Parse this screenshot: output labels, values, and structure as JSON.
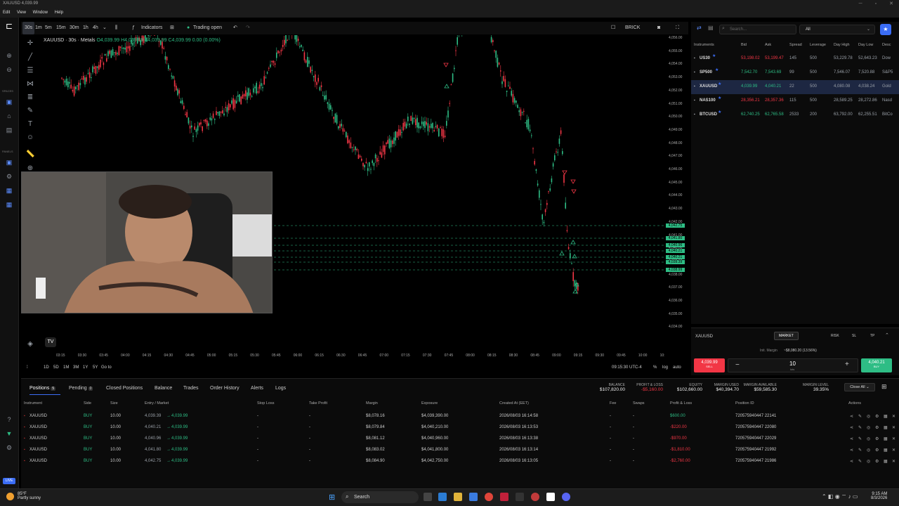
{
  "window": {
    "title": "XAUUSD 4,039.99",
    "menu": [
      "Edit",
      "View",
      "Window",
      "Help"
    ]
  },
  "toolbar": {
    "timeframes": [
      "30s",
      "1m",
      "5m",
      "15m",
      "30m",
      "1h",
      "4h"
    ],
    "active_timeframe": "30s",
    "indicators_label": "Indicators",
    "trading_status": "Trading open",
    "chart_type": "BRICK"
  },
  "chart": {
    "symbol_label": "XAUUSD · 30s · Metals",
    "ohlc": "O4,039.99 H4,039.99 L4,039.99 C4,039.99 0.00 (0.00%)",
    "y_labels": [
      "4,056.00",
      "4,055.00",
      "4,054.00",
      "4,053.00",
      "4,052.00",
      "4,051.00",
      "4,050.00",
      "4,049.00",
      "4,048.00",
      "4,047.00",
      "4,046.00",
      "4,045.00",
      "4,044.00",
      "4,043.00",
      "4,042.00",
      "4,041.00",
      "4,040.00",
      "4,039.00",
      "4,038.00",
      "4,037.00",
      "4,036.00",
      "4,035.00",
      "4,034.00"
    ],
    "price_tags": [
      "4,042.75",
      "4,041.80",
      "4,040.96",
      "4,040.21",
      "4,040.21",
      "4,039.39",
      "4,038.99"
    ],
    "x_labels": [
      "03:15",
      "03:30",
      "03:45",
      "04:00",
      "04:15",
      "04:30",
      "04:45",
      "05:00",
      "05:15",
      "05:30",
      "05:45",
      "06:00",
      "06:15",
      "06:30",
      "06:45",
      "07:00",
      "07:15",
      "07:30",
      "07:45",
      "08:00",
      "08:15",
      "08:30",
      "08:45",
      "09:00",
      "09:15",
      "09:30",
      "09:45",
      "10:00",
      "10:"
    ],
    "range_buttons": [
      "1D",
      "5D",
      "1M",
      "3M",
      "1Y",
      "5Y"
    ],
    "goto_label": "Go to",
    "time_display": "09:15:30 UTC-4",
    "scale_options": [
      "%",
      "log",
      "auto"
    ]
  },
  "sidebar_labels": {
    "spaces": "SPACES",
    "panels": "PANELS",
    "live": "LIVE"
  },
  "instruments": {
    "search_placeholder": "Search...",
    "filter": "All",
    "headers": [
      "Instruments",
      "Bid",
      "Ask",
      "Spread",
      "Leverage",
      "Day High",
      "Day Low",
      "Desc"
    ],
    "rows": [
      {
        "symbol": "US30",
        "bid": "53,198.02",
        "ask": "53,199.47",
        "spread": "145",
        "leverage": "500",
        "day_high": "53,229.78",
        "day_low": "52,643.23",
        "desc": "Dow",
        "dir": "down"
      },
      {
        "symbol": "SP500",
        "bid": "7,542.70",
        "ask": "7,543.69",
        "spread": "99",
        "leverage": "500",
        "day_high": "7,546.07",
        "day_low": "7,520.88",
        "desc": "S&P5",
        "dir": "up"
      },
      {
        "symbol": "XAUUSD",
        "bid": "4,039.99",
        "ask": "4,040.21",
        "spread": "22",
        "leverage": "500",
        "day_high": "4,080.08",
        "day_low": "4,038.24",
        "desc": "Gold",
        "dir": "up"
      },
      {
        "symbol": "NAS100",
        "bid": "28,356.21",
        "ask": "28,357.36",
        "spread": "115",
        "leverage": "500",
        "day_high": "28,589.25",
        "day_low": "28,272.86",
        "desc": "Nasd",
        "dir": "down"
      },
      {
        "symbol": "BTCUSD",
        "bid": "62,740.25",
        "ask": "62,765.58",
        "spread": "2533",
        "leverage": "200",
        "day_high": "63,792.00",
        "day_low": "62,255.51",
        "desc": "BitCo",
        "dir": "up"
      }
    ]
  },
  "order": {
    "symbol": "XAUUSD",
    "order_type": "MARKET",
    "tabs": [
      "RISK",
      "SL",
      "TP"
    ],
    "margin_label": "Init. Margin",
    "margin_value": "~$8,080.20 (13.56%)",
    "sell_price": "4,039.99",
    "sell_label": "SELL",
    "buy_price": "4,040.21",
    "buy_label": "BUY",
    "lots": "10",
    "lots_label": "lots"
  },
  "positions": {
    "tabs": [
      {
        "label": "Positions",
        "count": "5"
      },
      {
        "label": "Pending",
        "count": "0"
      },
      {
        "label": "Closed Positions"
      },
      {
        "label": "Balance"
      },
      {
        "label": "Trades"
      },
      {
        "label": "Order History"
      },
      {
        "label": "Alerts"
      },
      {
        "label": "Logs"
      }
    ],
    "stats": [
      {
        "k": "BALANCE",
        "v": "$107,820.00"
      },
      {
        "k": "PROFIT & LOSS",
        "v": "-$5,160.00"
      },
      {
        "k": "EQUITY",
        "v": "$102,660.00"
      },
      {
        "k": "MARGIN USED",
        "v": "$40,394.70"
      },
      {
        "k": "MARGIN AVAILABLE",
        "v": "$59,585.30"
      },
      {
        "k": "MARGIN LEVEL",
        "v": "39.35%"
      }
    ],
    "close_all": "Close All",
    "headers": [
      "Instrument",
      "Side",
      "Size",
      "Entry / Market",
      "Stop Loss",
      "Take Profit",
      "Margin",
      "Exposure",
      "Created At (EET)",
      "Fee",
      "Swaps",
      "Profit & Loss",
      "Position ID",
      "Actions"
    ],
    "rows": [
      {
        "inst": "XAUUSD",
        "side": "BUY",
        "size": "10.00",
        "entry": "4,039.39",
        "market": "4,039.99",
        "sl": "-",
        "tp": "-",
        "margin": "$8,078.16",
        "exposure": "$4,039,390.00",
        "created": "2026/08/03 16:14:58",
        "fee": "-",
        "swaps": "-",
        "pnl": "$600.00",
        "pnl_dir": "up",
        "id": "720575940447 22141"
      },
      {
        "inst": "XAUUSD",
        "side": "BUY",
        "size": "10.00",
        "entry": "4,040.21",
        "market": "4,039.99",
        "sl": "-",
        "tp": "-",
        "margin": "$8,079.84",
        "exposure": "$4,040,210.00",
        "created": "2026/08/03 16:13:53",
        "fee": "-",
        "swaps": "-",
        "pnl": "-$220.00",
        "pnl_dir": "down",
        "id": "720575940447 22080"
      },
      {
        "inst": "XAUUSD",
        "side": "BUY",
        "size": "10.00",
        "entry": "4,040.96",
        "market": "4,039.99",
        "sl": "-",
        "tp": "-",
        "margin": "$8,081.12",
        "exposure": "$4,040,960.00",
        "created": "2026/08/03 16:13:38",
        "fee": "-",
        "swaps": "-",
        "pnl": "-$970.00",
        "pnl_dir": "down",
        "id": "720575940447 22029"
      },
      {
        "inst": "XAUUSD",
        "side": "BUY",
        "size": "10.00",
        "entry": "4,041.80",
        "market": "4,039.99",
        "sl": "-",
        "tp": "-",
        "margin": "$8,083.02",
        "exposure": "$4,041,800.00",
        "created": "2026/08/03 16:13:14",
        "fee": "-",
        "swaps": "-",
        "pnl": "-$1,810.00",
        "pnl_dir": "down",
        "id": "720575940447 21992"
      },
      {
        "inst": "XAUUSD",
        "side": "BUY",
        "size": "10.00",
        "entry": "4,042.75",
        "market": "4,039.99",
        "sl": "-",
        "tp": "-",
        "margin": "$8,084.90",
        "exposure": "$4,042,750.00",
        "created": "2026/08/03 16:13:05",
        "fee": "-",
        "swaps": "-",
        "pnl": "-$2,760.00",
        "pnl_dir": "down",
        "id": "720575940447 21986"
      }
    ]
  },
  "taskbar": {
    "weather_temp": "85°F",
    "weather_desc": "Partly sunny",
    "search_label": "Search",
    "time": "9:15 AM",
    "date": "8/3/2026"
  },
  "colors": {
    "up": "#2ebd85",
    "down": "#f23645",
    "accent": "#3b6df5"
  }
}
